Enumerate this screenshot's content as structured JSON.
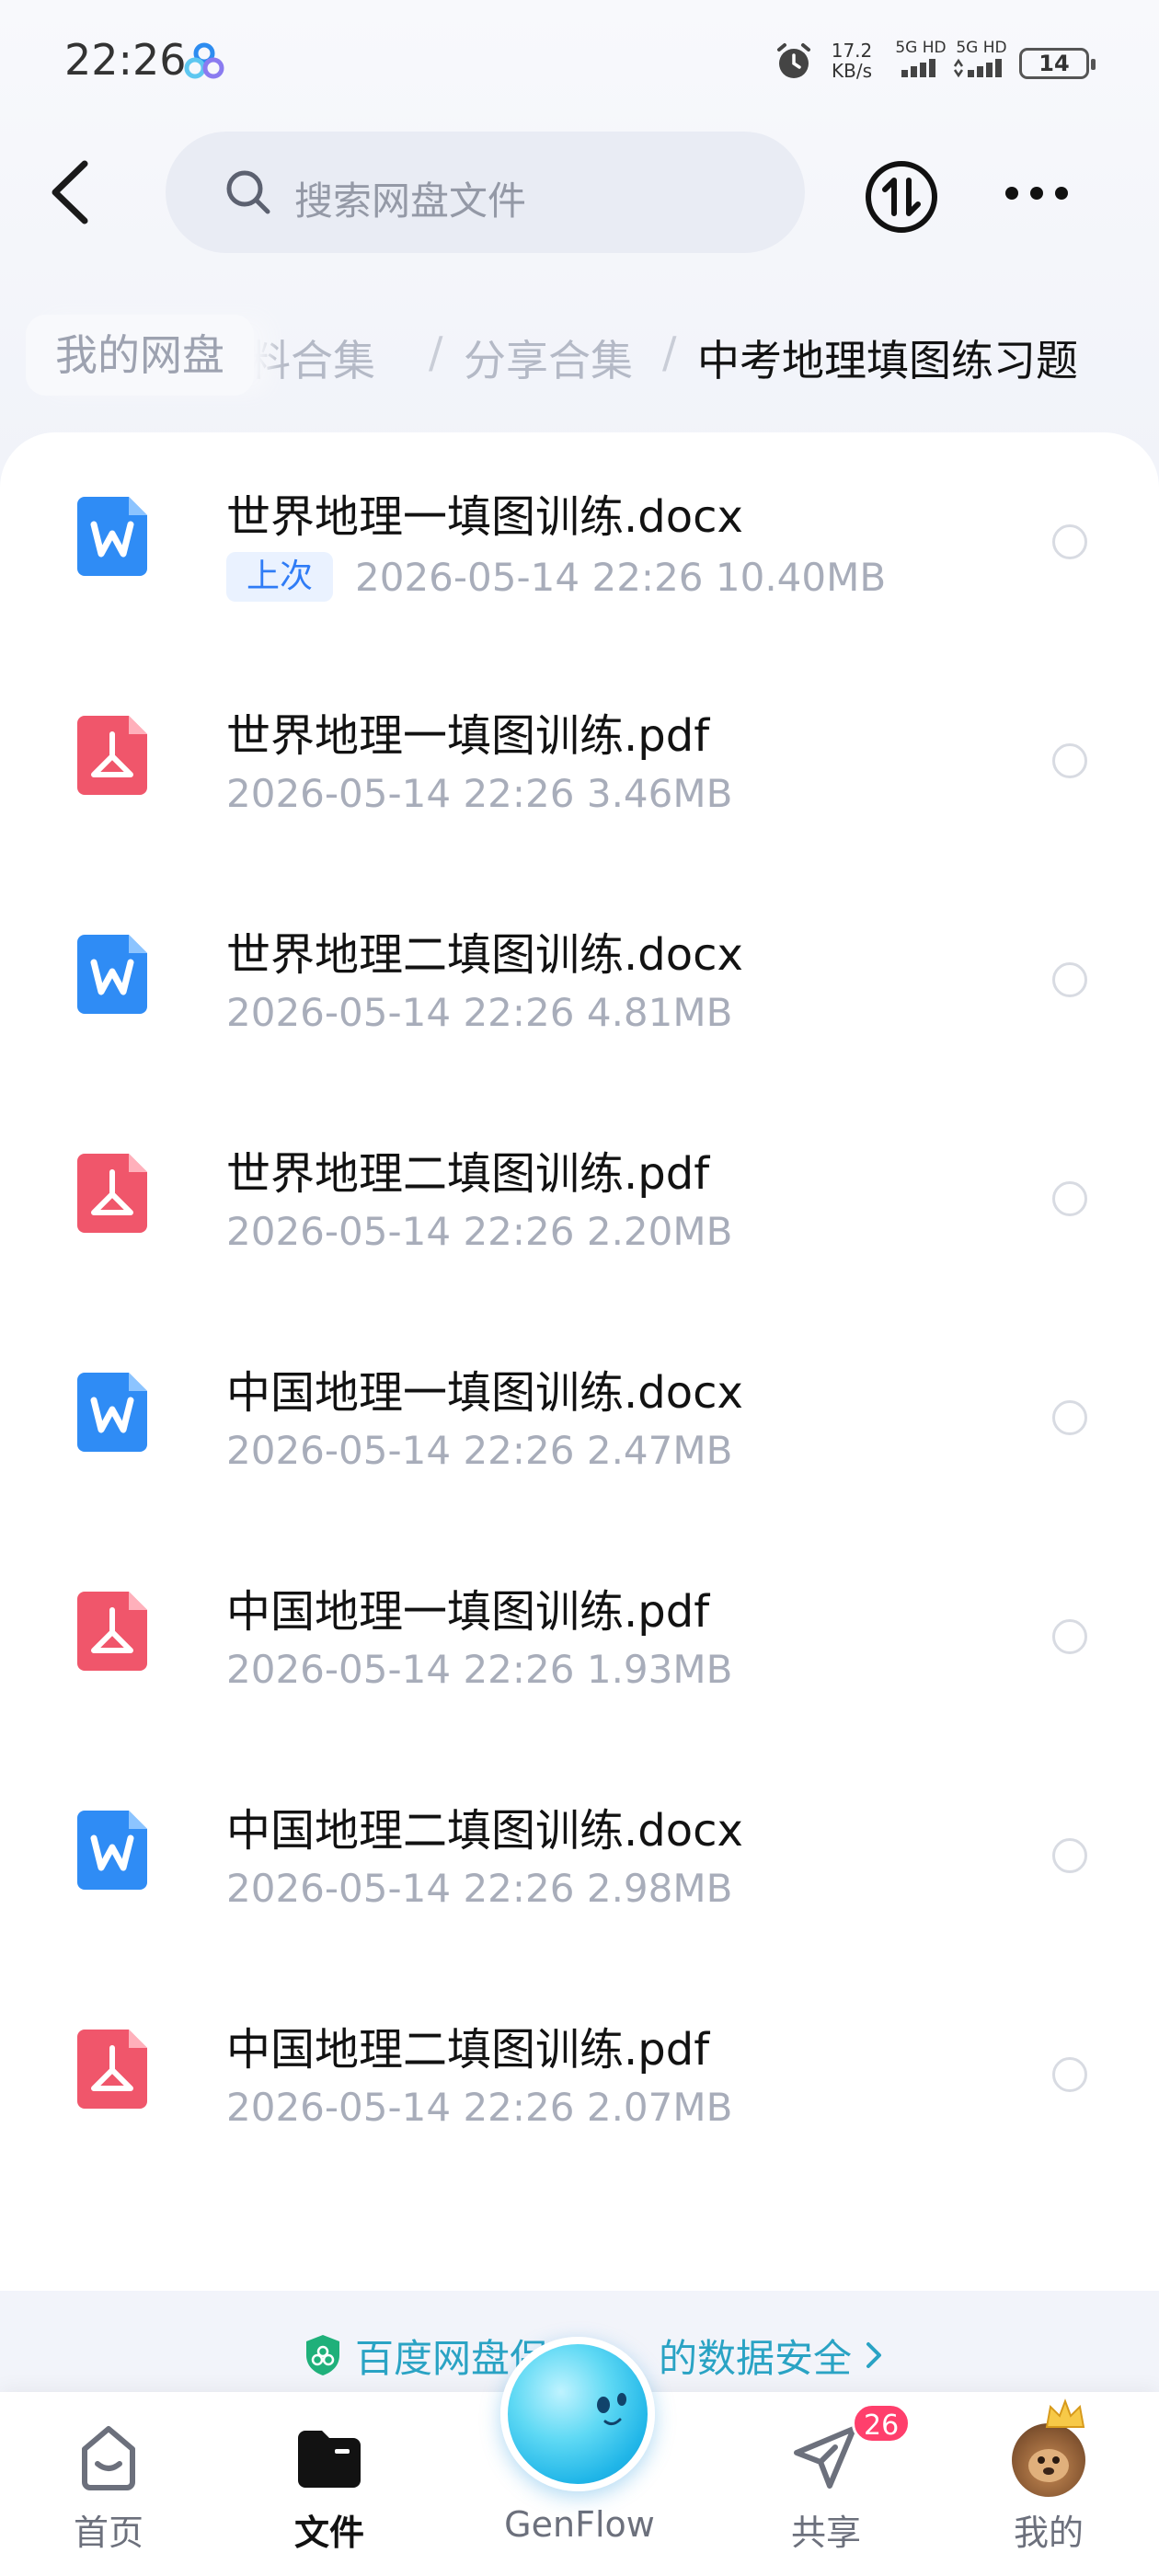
{
  "status_bar": {
    "time": "22:26",
    "net_speed_value": "17.2",
    "net_speed_unit": "KB/s",
    "sim1": "5G HD",
    "sim2": "5G HD",
    "battery": "14"
  },
  "header": {
    "search_placeholder": "搜索网盘文件",
    "icons": [
      "back-icon",
      "search-icon",
      "transfer-icon",
      "more-icon"
    ]
  },
  "breadcrumb": {
    "root": "我的网盘",
    "items": [
      "资料合集",
      "分享合集",
      "中考地理填图练习题"
    ],
    "partial_first": "料合集",
    "separator": "/"
  },
  "files": [
    {
      "name": "世界地理一填图训练.docx",
      "type": "docx",
      "tag": "上次",
      "date": "2026-05-14",
      "time": "22:26",
      "size": "10.40MB"
    },
    {
      "name": "世界地理一填图训练.pdf",
      "type": "pdf",
      "tag": "",
      "date": "2026-05-14",
      "time": "22:26",
      "size": "3.46MB"
    },
    {
      "name": "世界地理二填图训练.docx",
      "type": "docx",
      "tag": "",
      "date": "2026-05-14",
      "time": "22:26",
      "size": "4.81MB"
    },
    {
      "name": "世界地理二填图训练.pdf",
      "type": "pdf",
      "tag": "",
      "date": "2026-05-14",
      "time": "22:26",
      "size": "2.20MB"
    },
    {
      "name": "中国地理一填图训练.docx",
      "type": "docx",
      "tag": "",
      "date": "2026-05-14",
      "time": "22:26",
      "size": "2.47MB"
    },
    {
      "name": "中国地理一填图训练.pdf",
      "type": "pdf",
      "tag": "",
      "date": "2026-05-14",
      "time": "22:26",
      "size": "1.93MB"
    },
    {
      "name": "中国地理二填图训练.docx",
      "type": "docx",
      "tag": "",
      "date": "2026-05-14",
      "time": "22:26",
      "size": "2.98MB"
    },
    {
      "name": "中国地理二填图训练.pdf",
      "type": "pdf",
      "tag": "",
      "date": "2026-05-14",
      "time": "22:26",
      "size": "2.07MB"
    }
  ],
  "security_note": {
    "left": "百度网盘保",
    "right": "的数据安全"
  },
  "tabbar": {
    "tabs": [
      {
        "label": "首页",
        "icon": "home-icon",
        "active": false
      },
      {
        "label": "文件",
        "icon": "folder-icon",
        "active": true
      },
      {
        "label": "GenFlow",
        "icon": "genflow-icon",
        "active": false
      },
      {
        "label": "共享",
        "icon": "share-icon",
        "active": false
      },
      {
        "label": "我的",
        "icon": "avatar",
        "active": false
      }
    ],
    "share_badge": "26"
  },
  "colors": {
    "accent_blue": "#2f7cf6",
    "docx_icon": "#2f8cf5",
    "pdf_icon": "#f0566b",
    "security_text": "#2aa3c4",
    "badge": "#ff3f6c"
  }
}
